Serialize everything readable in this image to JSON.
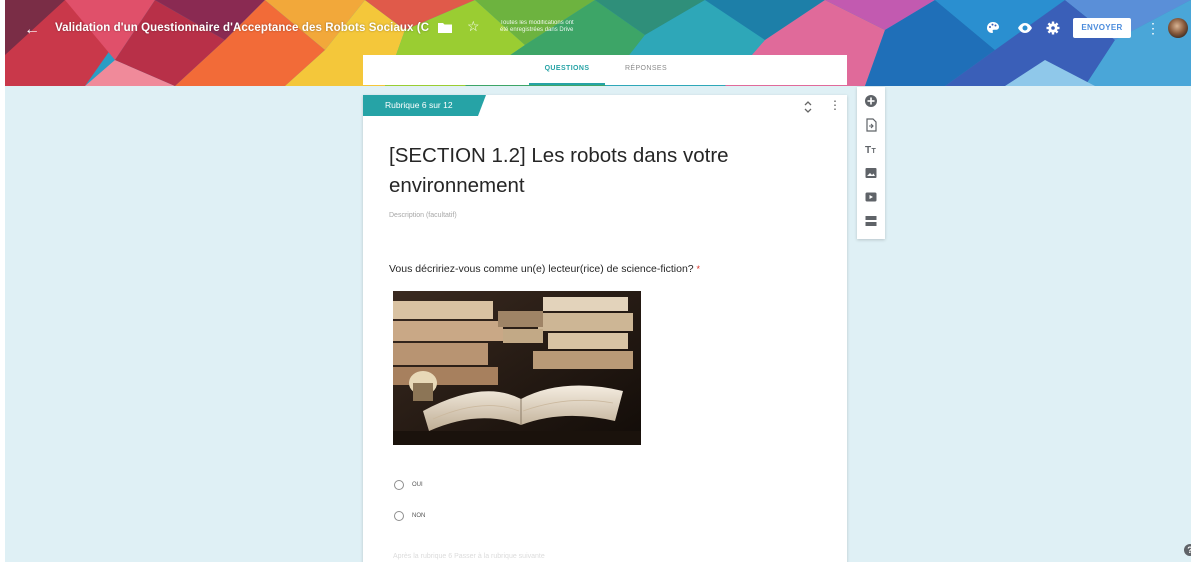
{
  "header": {
    "form_title": "Validation d'un Questionnaire d'Acceptance des Robots Sociaux (C",
    "save_status_line1": "Toutes les modifications ont",
    "save_status_line2": "été enregistrées dans Drive",
    "send_label": "ENVOYER",
    "icons": [
      "back-arrow-icon",
      "folder-icon",
      "star-icon",
      "palette-icon",
      "preview-eye-icon",
      "settings-gear-icon",
      "more-vert-icon",
      "avatar"
    ]
  },
  "tabs": {
    "questions": "QUESTIONS",
    "responses": "RÉPONSES",
    "active": "questions",
    "accent_color": "#26a3a6"
  },
  "section": {
    "tab_label": "Rubrique 6 sur 12",
    "title": "[SECTION 1.2] Les robots dans votre environnement",
    "description_placeholder": "Description (facultatif)"
  },
  "question": {
    "text": "Vous décririez-vous comme un(e) lecteur(rice) de science-fiction?",
    "required_marker": "*",
    "image_subject": "books-photo",
    "options": [
      "OUI",
      "NON"
    ]
  },
  "footer": {
    "faded_text": "Après la rubrique 6 Passer à la rubrique suivante"
  },
  "side_toolbar": {
    "tools": [
      "add-question-icon",
      "import-questions-icon",
      "add-title-icon",
      "add-image-icon",
      "add-video-icon",
      "add-section-icon"
    ]
  },
  "help_label": "?"
}
